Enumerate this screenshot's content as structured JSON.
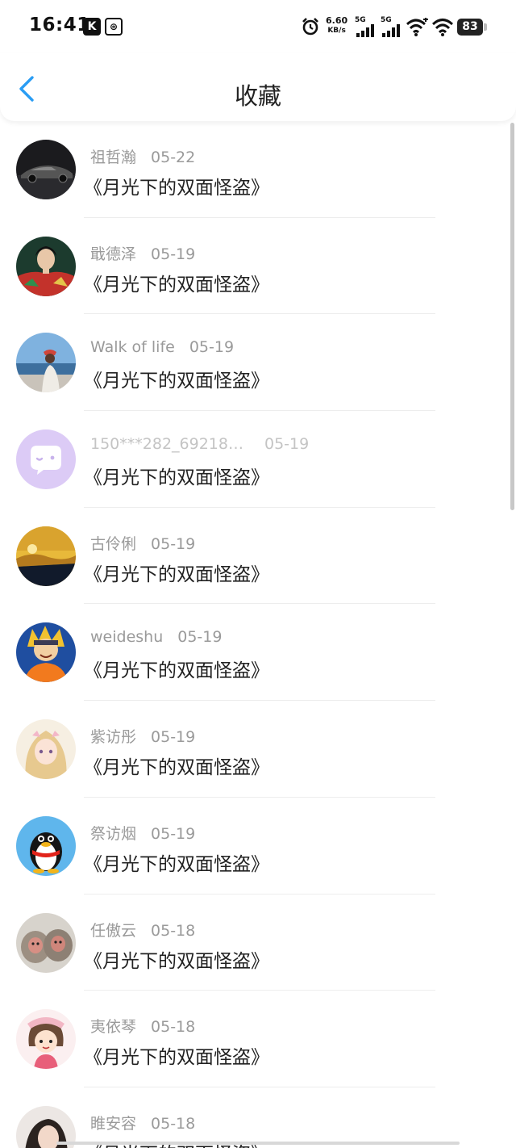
{
  "status_bar": {
    "time": "16:41",
    "net_speed_value": "6.60",
    "net_speed_unit": "KB/s",
    "signal1_label": "5G",
    "signal2_label": "5G",
    "battery": "83"
  },
  "header": {
    "title": "收藏"
  },
  "favorites": [
    {
      "name": "祖哲瀚",
      "date": "05-22",
      "book": "《月光下的双面怪盗》"
    },
    {
      "name": "戢德泽",
      "date": "05-19",
      "book": "《月光下的双面怪盗》"
    },
    {
      "name": "Walk of life",
      "date": "05-19",
      "book": "《月光下的双面怪盗》"
    },
    {
      "name": "150***282_69218…",
      "date": "05-19",
      "book": "《月光下的双面怪盗》"
    },
    {
      "name": "古伶俐",
      "date": "05-19",
      "book": "《月光下的双面怪盗》"
    },
    {
      "name": "weideshu",
      "date": "05-19",
      "book": "《月光下的双面怪盗》"
    },
    {
      "name": "紫访彤",
      "date": "05-19",
      "book": "《月光下的双面怪盗》"
    },
    {
      "name": "祭访烟",
      "date": "05-19",
      "book": "《月光下的双面怪盗》"
    },
    {
      "name": "任傲云",
      "date": "05-18",
      "book": "《月光下的双面怪盗》"
    },
    {
      "name": "夷依琴",
      "date": "05-18",
      "book": "《月光下的双面怪盗》"
    },
    {
      "name": "睢安容",
      "date": "05-18",
      "book": "《月光下的双面怪盗》"
    }
  ],
  "colors": {
    "accent": "#2a9df4",
    "meta_text": "#9a9a9a",
    "title_text": "#222222"
  }
}
